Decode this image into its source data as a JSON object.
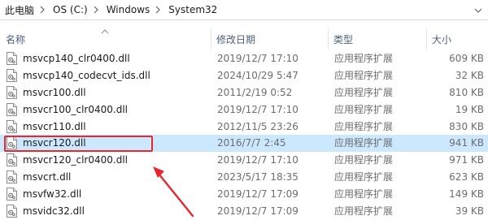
{
  "breadcrumb": {
    "items": [
      "此电脑",
      "OS (C:)",
      "Windows",
      "System32"
    ]
  },
  "columns": {
    "name": "名称",
    "date": "修改日期",
    "type": "类型",
    "size": "大小"
  },
  "files": [
    {
      "name": "msvcp140_clr0400.dll",
      "date": "2019/12/7 17:10",
      "type": "应用程序扩展",
      "size": "609 KB",
      "selected": false
    },
    {
      "name": "msvcp140_codecvt_ids.dll",
      "date": "2024/10/29 5:47",
      "type": "应用程序扩展",
      "size": "32 KB",
      "selected": false
    },
    {
      "name": "msvcr100.dll",
      "date": "2011/2/19 0:52",
      "type": "应用程序扩展",
      "size": "810 KB",
      "selected": false
    },
    {
      "name": "msvcr100_clr0400.dll",
      "date": "2019/12/7 17:10",
      "type": "应用程序扩展",
      "size": "19 KB",
      "selected": false
    },
    {
      "name": "msvcr110.dll",
      "date": "2012/11/5 23:26",
      "type": "应用程序扩展",
      "size": "830 KB",
      "selected": false
    },
    {
      "name": "msvcr120.dll",
      "date": "2016/7/7 2:45",
      "type": "应用程序扩展",
      "size": "941 KB",
      "selected": true
    },
    {
      "name": "msvcr120_clr0400.dll",
      "date": "2019/12/7 17:10",
      "type": "应用程序扩展",
      "size": "971 KB",
      "selected": false
    },
    {
      "name": "msvcrt.dll",
      "date": "2023/5/17 18:35",
      "type": "应用程序扩展",
      "size": "623 KB",
      "selected": false
    },
    {
      "name": "msvfw32.dll",
      "date": "2019/12/7 17:09",
      "type": "应用程序扩展",
      "size": "149 KB",
      "selected": false
    },
    {
      "name": "msvidc32.dll",
      "date": "2019/12/7 17:09",
      "type": "应用程序扩展",
      "size": "39 KB",
      "selected": false
    }
  ],
  "colors": {
    "selection": "#cce8ff",
    "highlight_box": "#e8262d",
    "annotation_arrow": "#e8262d",
    "header_text": "#4c607a"
  },
  "icons": {
    "breadcrumb_separator": "chevron-right-icon",
    "address_dropdown": "chevron-down-icon",
    "sort_indicator": "sort-up-icon",
    "file": "dll-file-icon"
  }
}
